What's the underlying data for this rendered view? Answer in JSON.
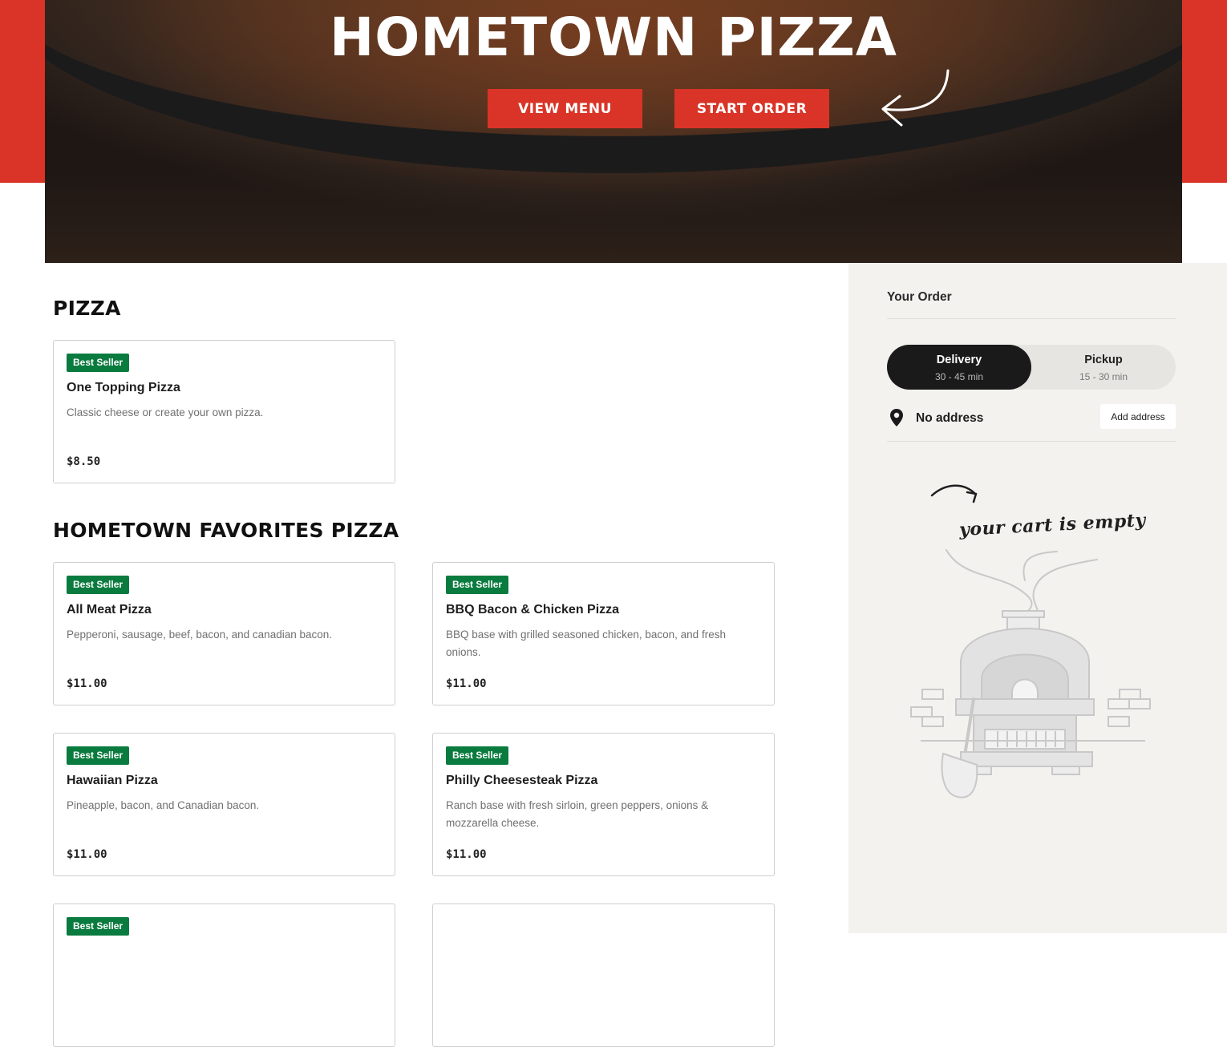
{
  "hero": {
    "title": "HOMETOWN PIZZA",
    "view_menu_label": "VIEW MENU",
    "start_order_label": "START ORDER"
  },
  "sections": [
    {
      "title": "PIZZA",
      "items": [
        {
          "badge": "Best Seller",
          "name": "One Topping Pizza",
          "description": "Classic cheese or create your own pizza.",
          "price": "$8.50"
        }
      ]
    },
    {
      "title": "HOMETOWN FAVORITES PIZZA",
      "items": [
        {
          "badge": "Best Seller",
          "name": "All Meat Pizza",
          "description": "Pepperoni, sausage, beef, bacon, and canadian bacon.",
          "price": "$11.00"
        },
        {
          "badge": "Best Seller",
          "name": "BBQ Bacon & Chicken Pizza",
          "description": "BBQ base with grilled seasoned chicken, bacon, and fresh onions.",
          "price": "$11.00"
        },
        {
          "badge": "Best Seller",
          "name": "Hawaiian Pizza",
          "description": "Pineapple, bacon, and Canadian bacon.",
          "price": "$11.00"
        },
        {
          "badge": "Best Seller",
          "name": "Philly Cheesesteak Pizza",
          "description": "Ranch base with fresh sirloin, green peppers, onions & mozzarella cheese.",
          "price": "$11.00"
        },
        {
          "badge": "Best Seller"
        }
      ]
    }
  ],
  "order": {
    "title": "Your Order",
    "delivery": {
      "label": "Delivery",
      "time": "30 - 45 min"
    },
    "pickup": {
      "label": "Pickup",
      "time": "15 - 30 min"
    },
    "address_text": "No address",
    "add_address_label": "Add address",
    "empty_cart_text": "your cart is empty",
    "selected_mode": "Delivery"
  },
  "colors": {
    "brand_red": "#d93427",
    "badge_green": "#0a7b3e",
    "sidebar_bg": "#f3f2ef",
    "toggle_active": "#1a1a1a"
  }
}
